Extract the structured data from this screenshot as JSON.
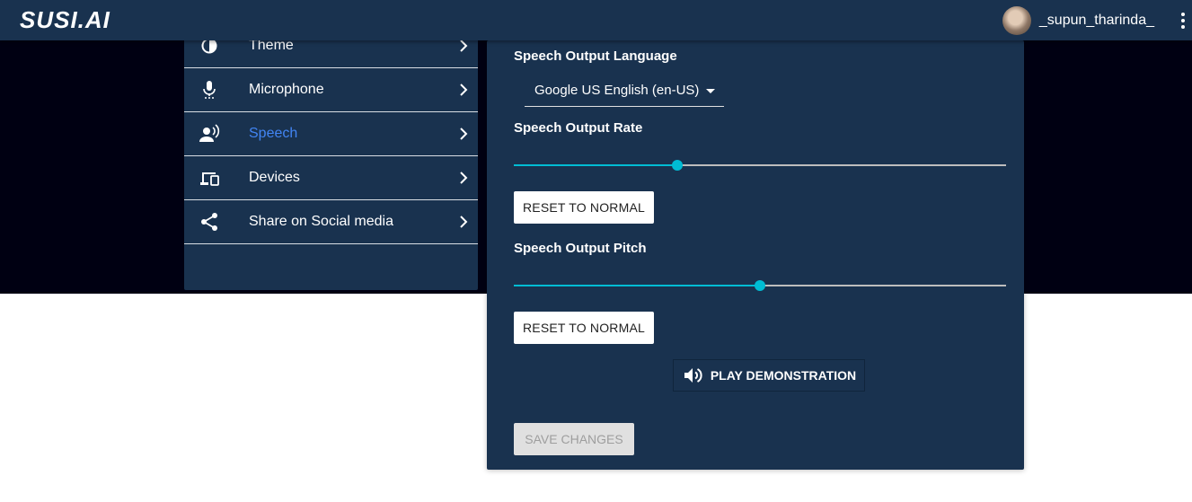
{
  "header": {
    "logo_text": "SUSI.AI",
    "username": "_supun_tharinda_"
  },
  "sidebar": {
    "items": [
      {
        "label": "Theme",
        "icon": "theme-icon",
        "active": false
      },
      {
        "label": "Microphone",
        "icon": "microphone-icon",
        "active": false
      },
      {
        "label": "Speech",
        "icon": "speech-icon",
        "active": true
      },
      {
        "label": "Devices",
        "icon": "devices-icon",
        "active": false
      },
      {
        "label": "Share on Social media",
        "icon": "share-icon",
        "active": false
      }
    ]
  },
  "speech": {
    "language_label": "Speech Output Language",
    "language_value": "Google US English (en-US)",
    "rate_label": "Speech Output Rate",
    "rate_value": 0.333,
    "pitch_label": "Speech Output Pitch",
    "pitch_value": 0.5,
    "reset_rate_label": "RESET TO NORMAL",
    "reset_pitch_label": "RESET TO NORMAL",
    "play_label": "PLAY DEMONSTRATION",
    "save_label": "SAVE CHANGES"
  },
  "colors": {
    "panel": "#19324f",
    "active_item": "#4285f4",
    "slider_accent": "#00bcd4"
  }
}
